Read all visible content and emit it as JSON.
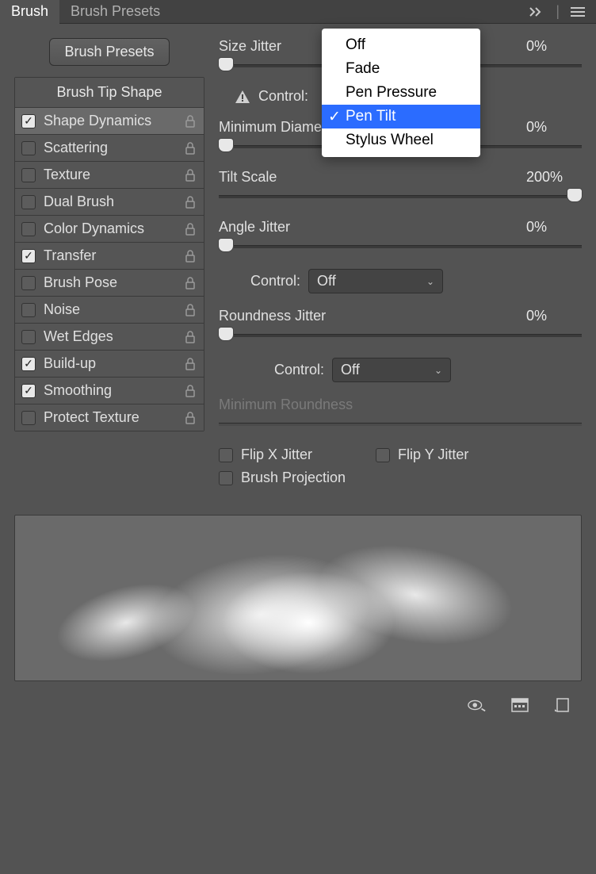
{
  "tabs": {
    "brush": "Brush",
    "presets": "Brush Presets"
  },
  "brushPresetsButton": "Brush Presets",
  "sidebar": {
    "header": "Brush Tip Shape",
    "items": [
      {
        "label": "Shape Dynamics",
        "checked": true,
        "selected": true,
        "locked": true
      },
      {
        "label": "Scattering",
        "checked": false,
        "selected": false,
        "locked": true
      },
      {
        "label": "Texture",
        "checked": false,
        "selected": false,
        "locked": true
      },
      {
        "label": "Dual Brush",
        "checked": false,
        "selected": false,
        "locked": true
      },
      {
        "label": "Color Dynamics",
        "checked": false,
        "selected": false,
        "locked": true
      },
      {
        "label": "Transfer",
        "checked": true,
        "selected": false,
        "locked": true
      },
      {
        "label": "Brush Pose",
        "checked": false,
        "selected": false,
        "locked": true
      },
      {
        "label": "Noise",
        "checked": false,
        "selected": false,
        "locked": true
      },
      {
        "label": "Wet Edges",
        "checked": false,
        "selected": false,
        "locked": true
      },
      {
        "label": "Build-up",
        "checked": true,
        "selected": false,
        "locked": true
      },
      {
        "label": "Smoothing",
        "checked": true,
        "selected": false,
        "locked": true
      },
      {
        "label": "Protect Texture",
        "checked": false,
        "selected": false,
        "locked": true
      }
    ]
  },
  "settings": {
    "sizeJitter": {
      "label": "Size Jitter",
      "value": "0%"
    },
    "control": {
      "label": "Control:",
      "value": "Pen Tilt"
    },
    "minDiameter": {
      "label": "Minimum Diameter",
      "value": "0%"
    },
    "tiltScale": {
      "label": "Tilt Scale",
      "value": "200%"
    },
    "angleJitter": {
      "label": "Angle Jitter",
      "value": "0%"
    },
    "angleControl": {
      "label": "Control:",
      "value": "Off"
    },
    "roundnessJitter": {
      "label": "Roundness Jitter",
      "value": "0%"
    },
    "roundnessControl": {
      "label": "Control:",
      "value": "Off"
    },
    "minRoundness": {
      "label": "Minimum Roundness"
    },
    "flipX": "Flip X Jitter",
    "flipY": "Flip Y Jitter",
    "brushProjection": "Brush Projection"
  },
  "popup": {
    "items": [
      {
        "label": "Off",
        "selected": false
      },
      {
        "label": "Fade",
        "selected": false
      },
      {
        "label": "Pen Pressure",
        "selected": false
      },
      {
        "label": "Pen Tilt",
        "selected": true
      },
      {
        "label": "Stylus Wheel",
        "selected": false
      }
    ]
  }
}
